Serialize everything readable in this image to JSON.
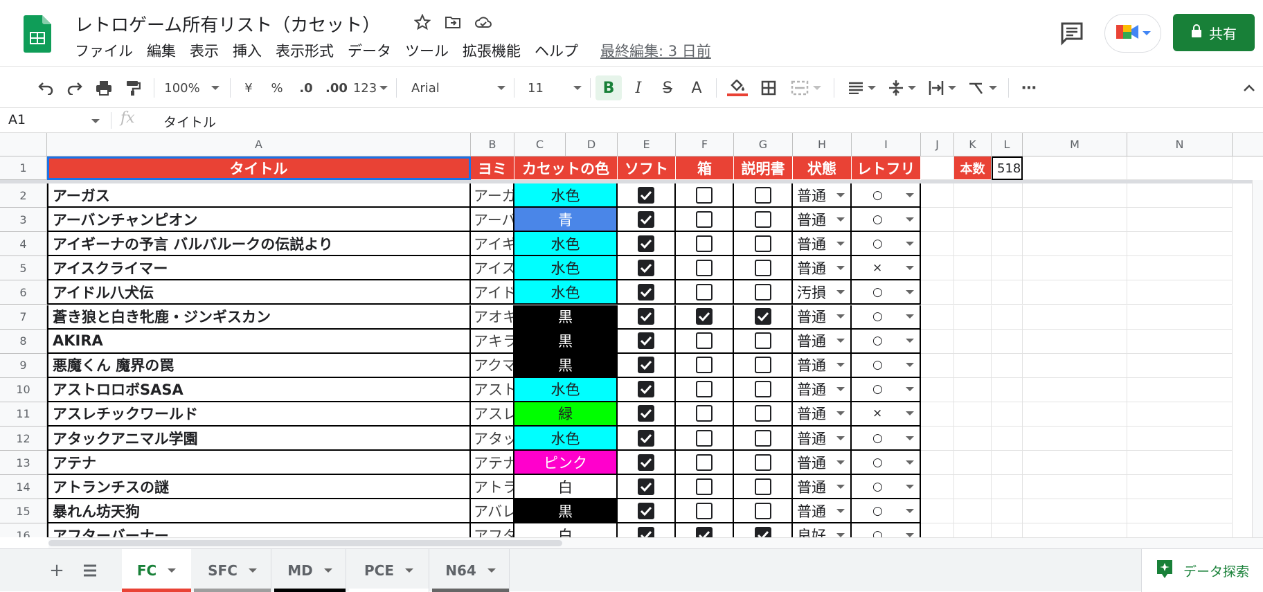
{
  "doc": {
    "title": "レトロゲーム所有リスト（カセット）",
    "menus": [
      "ファイル",
      "編集",
      "表示",
      "挿入",
      "表示形式",
      "データ",
      "ツール",
      "拡張機能",
      "ヘルプ"
    ],
    "last_edit": "最終編集: 3 日前",
    "share_label": "共有"
  },
  "toolbar": {
    "zoom": "100%",
    "currency": "¥",
    "percent": "%",
    "dec_less": ".0",
    "dec_more": ".00",
    "number_format": "123",
    "font": "Arial",
    "font_size": "11",
    "bold": "B",
    "italic": "I",
    "strike": "S",
    "text_color": "A",
    "more": "⋯"
  },
  "formula": {
    "cell_ref": "A1",
    "fx": "fx",
    "value": "タイトル"
  },
  "columns": [
    "A",
    "B",
    "C",
    "D",
    "E",
    "F",
    "G",
    "H",
    "I",
    "J",
    "K",
    "L",
    "M",
    "N"
  ],
  "header_row": {
    "title": "タイトル",
    "yomi": "ヨミ",
    "color": "カセットの色",
    "soft": "ソフト",
    "box": "箱",
    "manual": "説明書",
    "state": "状態",
    "retrofree": "レトフリ",
    "count_label": "本数",
    "count_value": "518"
  },
  "rows": [
    {
      "n": "2",
      "title": "アーガス",
      "yomi": "アーガ",
      "color": "水色",
      "bg": "#00ffff",
      "fg": "#202124",
      "soft": true,
      "box": false,
      "manual": false,
      "state": "普通",
      "rf": "○"
    },
    {
      "n": "3",
      "title": "アーバンチャンピオン",
      "yomi": "アーバ",
      "color": "青",
      "bg": "#4a86e8",
      "fg": "#ffffff",
      "soft": true,
      "box": false,
      "manual": false,
      "state": "普通",
      "rf": "○"
    },
    {
      "n": "4",
      "title": "アイギーナの予言 バルバルークの伝説より",
      "yomi": "アイギ",
      "color": "水色",
      "bg": "#00ffff",
      "fg": "#202124",
      "soft": true,
      "box": false,
      "manual": false,
      "state": "普通",
      "rf": "○"
    },
    {
      "n": "5",
      "title": "アイスクライマー",
      "yomi": "アイス",
      "color": "水色",
      "bg": "#00ffff",
      "fg": "#202124",
      "soft": true,
      "box": false,
      "manual": false,
      "state": "普通",
      "rf": "×"
    },
    {
      "n": "6",
      "title": "アイドル八犬伝",
      "yomi": "アイド",
      "color": "水色",
      "bg": "#00ffff",
      "fg": "#202124",
      "soft": true,
      "box": false,
      "manual": false,
      "state": "汚損",
      "rf": "○"
    },
    {
      "n": "7",
      "title": "蒼き狼と白き牝鹿・ジンギスカン",
      "yomi": "アオキ",
      "color": "黒",
      "bg": "#000000",
      "fg": "#ffffff",
      "soft": true,
      "box": true,
      "manual": true,
      "state": "普通",
      "rf": "○"
    },
    {
      "n": "8",
      "title": "AKIRA",
      "yomi": "アキラ",
      "color": "黒",
      "bg": "#000000",
      "fg": "#ffffff",
      "soft": true,
      "box": false,
      "manual": false,
      "state": "普通",
      "rf": "○"
    },
    {
      "n": "9",
      "title": "悪魔くん 魔界の罠",
      "yomi": "アクマ",
      "color": "黒",
      "bg": "#000000",
      "fg": "#ffffff",
      "soft": true,
      "box": false,
      "manual": false,
      "state": "普通",
      "rf": "○"
    },
    {
      "n": "10",
      "title": "アストロロボSASA",
      "yomi": "アスト",
      "color": "水色",
      "bg": "#00ffff",
      "fg": "#202124",
      "soft": true,
      "box": false,
      "manual": false,
      "state": "普通",
      "rf": "○"
    },
    {
      "n": "11",
      "title": "アスレチックワールド",
      "yomi": "アスレ",
      "color": "緑",
      "bg": "#00ff00",
      "fg": "#202124",
      "soft": true,
      "box": false,
      "manual": false,
      "state": "普通",
      "rf": "×"
    },
    {
      "n": "12",
      "title": "アタックアニマル学園",
      "yomi": "アタッ",
      "color": "水色",
      "bg": "#00ffff",
      "fg": "#202124",
      "soft": true,
      "box": false,
      "manual": false,
      "state": "普通",
      "rf": "○"
    },
    {
      "n": "13",
      "title": "アテナ",
      "yomi": "アテナ",
      "color": "ピンク",
      "bg": "#ff00cc",
      "fg": "#ffffff",
      "soft": true,
      "box": false,
      "manual": false,
      "state": "普通",
      "rf": "○"
    },
    {
      "n": "14",
      "title": "アトランチスの謎",
      "yomi": "アトラ",
      "color": "白",
      "bg": "#ffffff",
      "fg": "#202124",
      "soft": true,
      "box": false,
      "manual": false,
      "state": "普通",
      "rf": "○"
    },
    {
      "n": "15",
      "title": "暴れん坊天狗",
      "yomi": "アバレ",
      "color": "黒",
      "bg": "#000000",
      "fg": "#ffffff",
      "soft": true,
      "box": false,
      "manual": false,
      "state": "普通",
      "rf": "○"
    },
    {
      "n": "16",
      "title": "アフターバーナー",
      "yomi": "アフタ",
      "color": "白",
      "bg": "#ffffff",
      "fg": "#202124",
      "soft": true,
      "box": true,
      "manual": true,
      "state": "良好",
      "rf": "○"
    }
  ],
  "sheets": [
    {
      "name": "FC",
      "active": true,
      "color": "#e94235"
    },
    {
      "name": "SFC",
      "active": false,
      "color": "#9e9e9e"
    },
    {
      "name": "MD",
      "active": false,
      "color": "#000000"
    },
    {
      "name": "PCE",
      "active": false,
      "color": "#ffffff"
    },
    {
      "name": "N64",
      "active": false,
      "color": "#666666"
    }
  ],
  "explore_label": "データ探索",
  "colors": {
    "accent": "#188038",
    "header_red": "#e94235"
  }
}
